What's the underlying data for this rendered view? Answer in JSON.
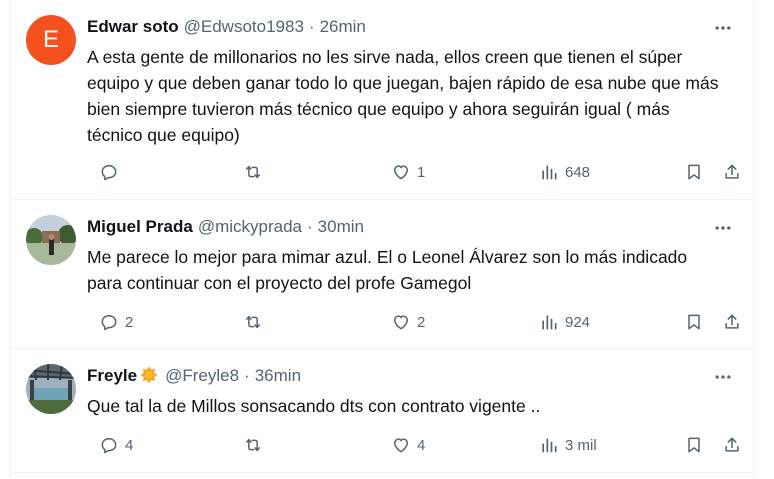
{
  "tweets": [
    {
      "avatar_letter": "E",
      "avatar_color": "#f4511e",
      "name": "Edwar soto",
      "handle": "@Edwsoto1983",
      "separator": "·",
      "time": "26min",
      "text": "A esta gente de millonarios no les sirve nada, ellos creen que tienen el súper equipo y que deben ganar todo lo que juegan, bajen rápido de esa nube que más bien siempre tuvieron más técnico que equipo y ahora seguirán igual ( más técnico que equipo)",
      "replies": "",
      "retweets": "",
      "likes": "1",
      "views": "648"
    },
    {
      "avatar_letter": "",
      "name": "Miguel Prada",
      "handle": "@mickyprada",
      "separator": "·",
      "time": "30min",
      "text": "Me parece lo mejor para mimar azul. El o Leonel Álvarez son lo más indicado para continuar con el proyecto del profe Gamegol",
      "replies": "2",
      "retweets": "",
      "likes": "2",
      "views": "924"
    },
    {
      "avatar_letter": "",
      "name": "Freyle",
      "handle": "@Freyle8",
      "separator": "·",
      "time": "36min",
      "text": "Que tal la de Millos sonsacando  dts  con contrato vigente ..",
      "replies": "4",
      "retweets": "",
      "likes": "4",
      "views": "3 mil"
    }
  ],
  "icons": {
    "more": "more-horizontal-icon",
    "reply": "reply-bubble-icon",
    "retweet": "retweet-icon",
    "like": "heart-icon",
    "views": "views-chart-icon",
    "bookmark": "bookmark-icon",
    "share": "share-icon",
    "badge": "sun-badge-icon"
  },
  "colors": {
    "text": "#0f1419",
    "secondary": "#536471",
    "border": "#eff3f4",
    "badge": "#f5a623"
  }
}
